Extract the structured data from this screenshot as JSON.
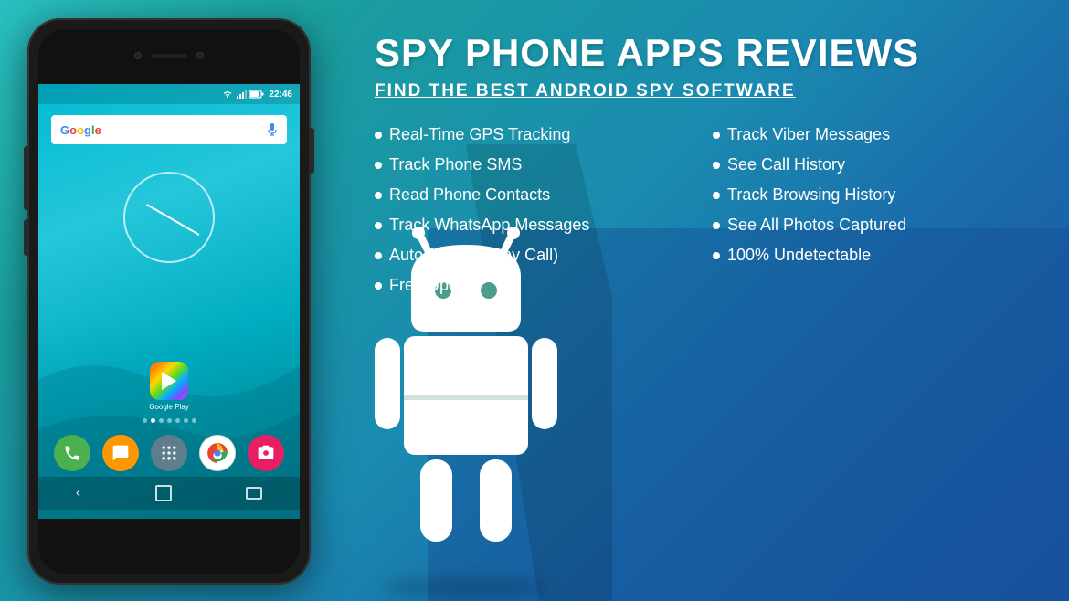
{
  "header": {
    "main_title": "SPY PHONE APPS REVIEWS",
    "subtitle": "FIND THE BEST ANDROID SPY SOFTWARE"
  },
  "status_bar": {
    "time": "22:46"
  },
  "google_search": {
    "label": "Google"
  },
  "play_store": {
    "label": "Google Play"
  },
  "features": {
    "col1": [
      {
        "text": "Real-Time GPS Tracking"
      },
      {
        "text": "Track Phone SMS"
      },
      {
        "text": "Read Phone Contacts"
      },
      {
        "text": "Track WhatsApp Messages"
      },
      {
        "text": "Auto Answer (Spy Call)"
      },
      {
        "text": "Free Update"
      }
    ],
    "col2": [
      {
        "text": "Track Viber Messages"
      },
      {
        "text": "See Call History"
      },
      {
        "text": "Track Browsing History"
      },
      {
        "text": "See All Photos Captured"
      },
      {
        "text": "100% Undetectable"
      }
    ]
  },
  "colors": {
    "bg_teal": "#2abfbf",
    "bg_blue": "#1a50a0",
    "accent": "#ffffff"
  }
}
